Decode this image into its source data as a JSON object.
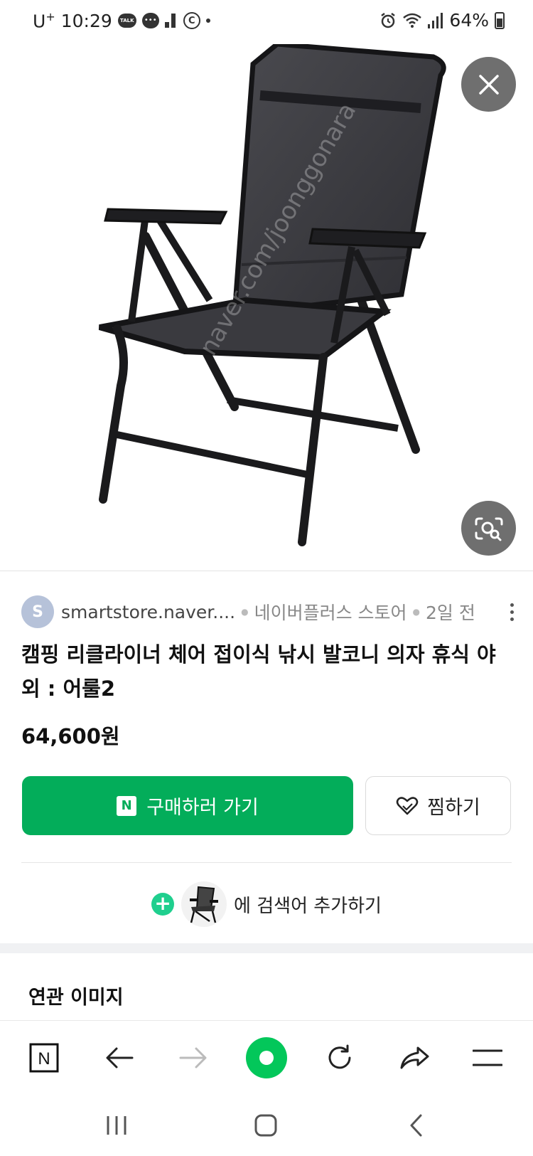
{
  "status_bar": {
    "carrier": "U",
    "carrier_sup": "+",
    "time": "10:29",
    "talk_icon_text": "TALK",
    "battery_percent": "64%",
    "icons": [
      "kakaotalk-icon",
      "chat-icon",
      "data-usage-icon",
      "c-badge-icon",
      "dot-icon",
      "alarm-icon",
      "wifi-icon",
      "signal-icon",
      "battery-icon"
    ]
  },
  "image_viewer": {
    "close_icon": "close-icon",
    "lens_icon": "image-search-icon",
    "watermark": "naver.com/joonggonara"
  },
  "source": {
    "avatar_letter": "S",
    "domain": "smartstore.naver....",
    "store": "네이버플러스 스토어",
    "time_ago": "2일 전"
  },
  "product": {
    "title": "캠핑 리클라이너 체어 접이식 낚시 발코니 의자 휴식 야외 : 어룰2",
    "price": "64,600원"
  },
  "actions": {
    "buy_badge": "N",
    "buy_label": "구매하러 가기",
    "wish_label": "찜하기"
  },
  "add_search": {
    "plus": "+",
    "label": "에 검색어 추가하기"
  },
  "related": {
    "title": "연관 이미지"
  },
  "colors": {
    "naver_green": "#03ad5a",
    "plus_green": "#1fcf8e"
  }
}
